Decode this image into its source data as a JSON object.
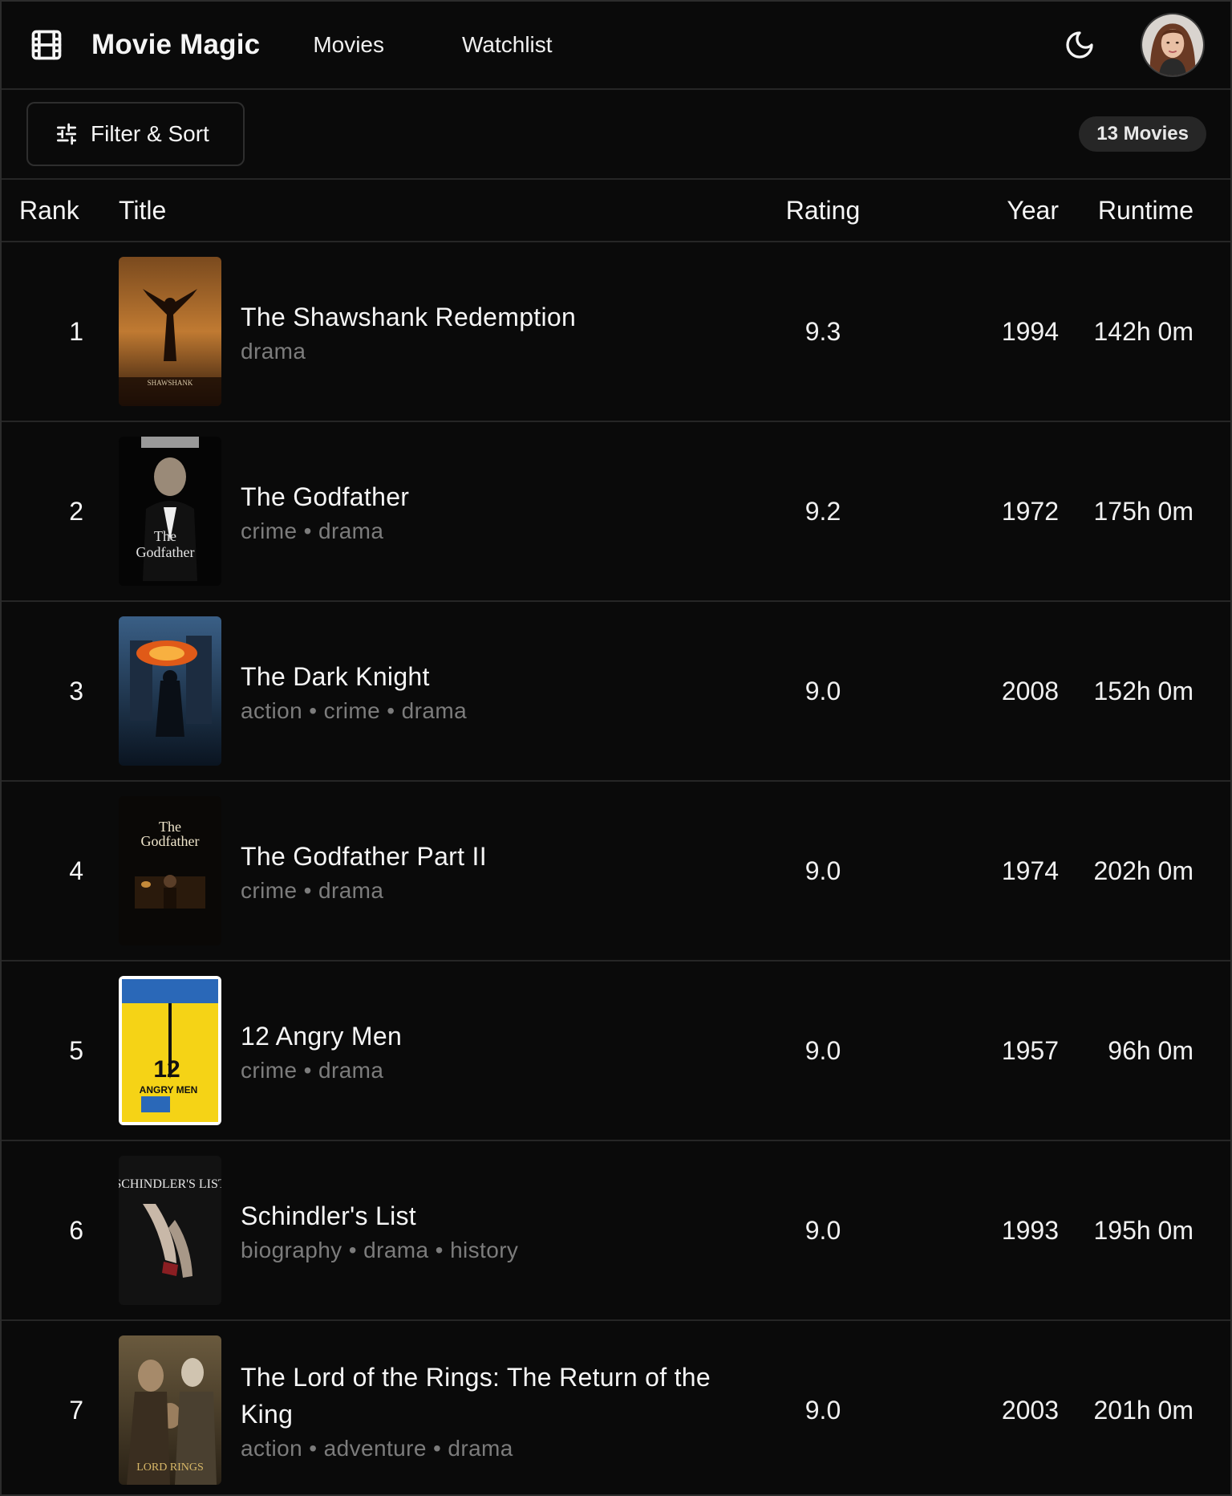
{
  "header": {
    "app_title": "Movie Magic",
    "nav": [
      {
        "label": "Movies"
      },
      {
        "label": "Watchlist"
      }
    ]
  },
  "toolbar": {
    "filter_label": "Filter & Sort",
    "count_label": "13 Movies"
  },
  "table": {
    "columns": {
      "rank": "Rank",
      "title": "Title",
      "rating": "Rating",
      "year": "Year",
      "runtime": "Runtime"
    },
    "rows": [
      {
        "rank": "1",
        "title": "The Shawshank Redemption",
        "genres": "drama",
        "rating": "9.3",
        "year": "1994",
        "runtime": "142h 0m",
        "poster": "poster-shawshank"
      },
      {
        "rank": "2",
        "title": "The Godfather",
        "genres": "crime • drama",
        "rating": "9.2",
        "year": "1972",
        "runtime": "175h 0m",
        "poster": "poster-godfather"
      },
      {
        "rank": "3",
        "title": "The Dark Knight",
        "genres": "action • crime • drama",
        "rating": "9.0",
        "year": "2008",
        "runtime": "152h 0m",
        "poster": "poster-dark-knight"
      },
      {
        "rank": "4",
        "title": "The Godfather Part II",
        "genres": "crime • drama",
        "rating": "9.0",
        "year": "1974",
        "runtime": "202h 0m",
        "poster": "poster-godfather-2"
      },
      {
        "rank": "5",
        "title": "12 Angry Men",
        "genres": "crime • drama",
        "rating": "9.0",
        "year": "1957",
        "runtime": "96h 0m",
        "poster": "poster-12-angry-men"
      },
      {
        "rank": "6",
        "title": "Schindler's List",
        "genres": "biography • drama • history",
        "rating": "9.0",
        "year": "1993",
        "runtime": "195h 0m",
        "poster": "poster-schindlers-list"
      },
      {
        "rank": "7",
        "title": "The Lord of the Rings: The Return of the King",
        "genres": "action • adventure • drama",
        "rating": "9.0",
        "year": "2003",
        "runtime": "201h 0m",
        "poster": "poster-lotr-return-king"
      }
    ]
  },
  "icons": {
    "logo": "film-icon",
    "theme": "moon-icon",
    "filter": "sliders-icon"
  }
}
